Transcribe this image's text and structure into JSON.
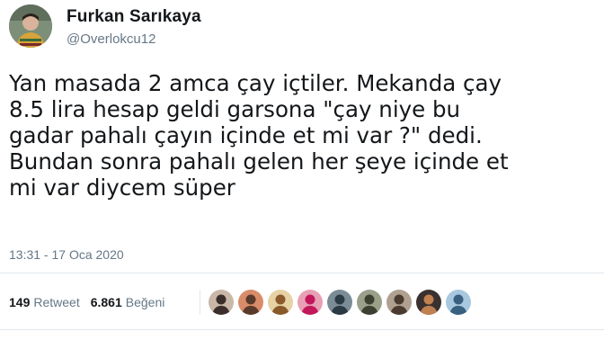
{
  "tweet": {
    "author": {
      "name": "Furkan Sarıkaya",
      "handle": "@Overlokcu12"
    },
    "text": "Yan masada 2 amca çay içtiler. Mekanda çay\n8.5 lira hesap geldi garsona \"çay niye bu\ngadar pahalı çayın içinde et mi var ?\" dedi.\nBundan sonra pahalı gelen her şeye içinde et\nmi var diycem süper",
    "timestamp": "13:31 - 17 Oca 2020",
    "retweets": {
      "count": "149",
      "label": "Retweet"
    },
    "likes": {
      "count": "6.861",
      "label": "Beğeni"
    }
  },
  "liker_avatars": [
    {
      "name": "liker-avatar-1",
      "bg": "#c9b8a8",
      "fg": "#3a2f2a"
    },
    {
      "name": "liker-avatar-2",
      "bg": "#d98c6a",
      "fg": "#5a3a2a"
    },
    {
      "name": "liker-avatar-3",
      "bg": "#e7d2a6",
      "fg": "#8a5a2b"
    },
    {
      "name": "liker-avatar-4",
      "bg": "#e8a0b4",
      "fg": "#c2185b"
    },
    {
      "name": "liker-avatar-5",
      "bg": "#7c8c96",
      "fg": "#2b3a44"
    },
    {
      "name": "liker-avatar-6",
      "bg": "#9aa08a",
      "fg": "#3c4030"
    },
    {
      "name": "liker-avatar-7",
      "bg": "#b0a090",
      "fg": "#4a3a30"
    },
    {
      "name": "liker-avatar-8",
      "bg": "#3a3030",
      "fg": "#c08050"
    },
    {
      "name": "liker-avatar-9",
      "bg": "#a8c8e0",
      "fg": "#3a6080"
    }
  ]
}
